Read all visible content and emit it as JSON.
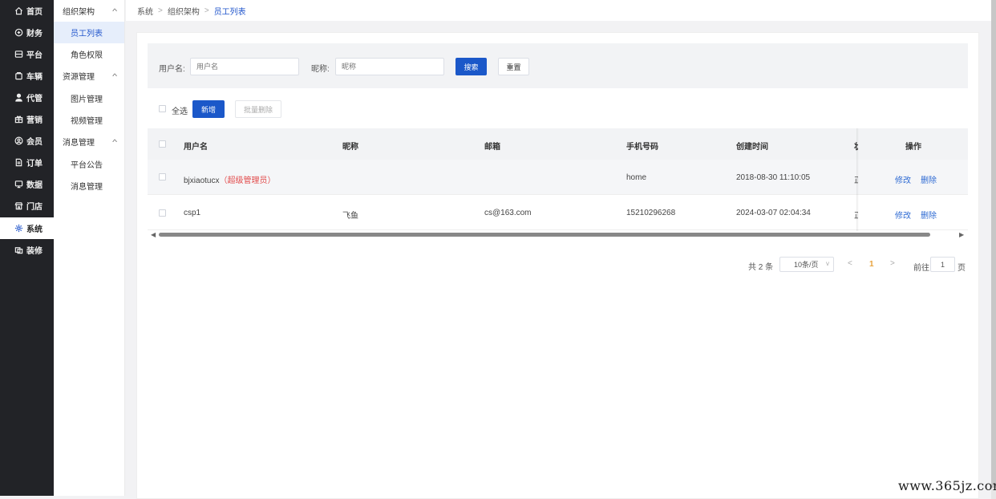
{
  "nav": {
    "items": [
      {
        "label": "首页",
        "icon": "home-icon"
      },
      {
        "label": "财务",
        "icon": "shield-icon"
      },
      {
        "label": "平台",
        "icon": "server-icon"
      },
      {
        "label": "车辆",
        "icon": "cart-icon"
      },
      {
        "label": "代管",
        "icon": "user-icon"
      },
      {
        "label": "营销",
        "icon": "gift-icon"
      },
      {
        "label": "会员",
        "icon": "member-icon"
      },
      {
        "label": "订单",
        "icon": "document-icon"
      },
      {
        "label": "数据",
        "icon": "monitor-icon"
      },
      {
        "label": "门店",
        "icon": "store-icon"
      },
      {
        "label": "系统",
        "icon": "gear-icon",
        "active": true
      },
      {
        "label": "装修",
        "icon": "brush-icon"
      }
    ]
  },
  "subnav": {
    "groups": [
      {
        "title": "组织架构",
        "items": [
          "员工列表",
          "角色权限"
        ]
      },
      {
        "title": "资源管理",
        "items": [
          "图片管理",
          "视频管理"
        ]
      },
      {
        "title": "消息管理",
        "items": [
          "平台公告",
          "消息管理"
        ]
      }
    ],
    "active_item": "员工列表"
  },
  "breadcrumb": [
    "系统",
    "组织架构",
    "员工列表"
  ],
  "search": {
    "username_label": "用户名:",
    "username_placeholder": "用户名",
    "nickname_label": "昵称:",
    "nickname_placeholder": "昵称",
    "search_button": "搜索",
    "reset_button": "重置"
  },
  "toolbar": {
    "select_all_label": "全选",
    "add_button": "新增",
    "batch_delete_button": "批量删除"
  },
  "table": {
    "columns": [
      "用户名",
      "昵称",
      "邮箱",
      "手机号码",
      "创建时间",
      "状",
      "操作"
    ],
    "rows": [
      {
        "username": "bjxiaotucx",
        "role_tag": "（超级管理员）",
        "nickname": "",
        "email": "",
        "phone": "home",
        "created": "2018-08-30 11:10:05",
        "status": "正",
        "edit": "修改",
        "delete": "删除"
      },
      {
        "username": "csp1",
        "role_tag": "",
        "nickname": "飞鱼",
        "email": "cs@163.com",
        "phone": "15210296268",
        "created": "2024-03-07 02:04:34",
        "status": "正",
        "edit": "修改",
        "delete": "删除"
      }
    ]
  },
  "pagination": {
    "total": "共 2 条",
    "page_size": "10条/页",
    "current_page": "1",
    "goto_prefix": "前往",
    "goto_value": "1",
    "goto_suffix": "页"
  },
  "watermark": "www.365jz.com",
  "colors": {
    "primary": "#1b58c9",
    "sidebar": "#222327",
    "danger": "#e24a4a",
    "link": "#2f6bd3"
  }
}
